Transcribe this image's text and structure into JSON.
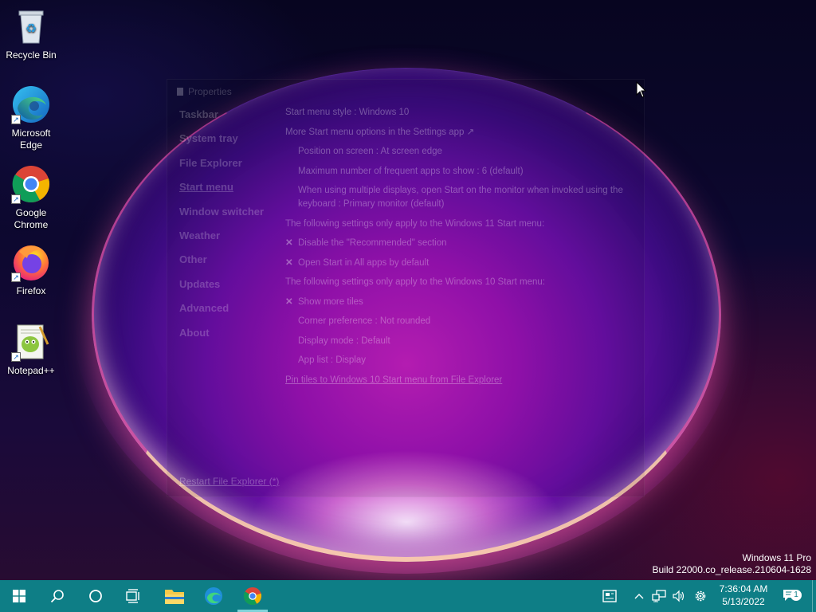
{
  "desktop": {
    "icons": [
      {
        "label": "Recycle Bin"
      },
      {
        "label": "Microsoft Edge"
      },
      {
        "label": "Google Chrome"
      },
      {
        "label": "Firefox"
      },
      {
        "label": "Notepad++"
      }
    ]
  },
  "properties": {
    "title": "Properties",
    "nav": [
      {
        "label": "Taskbar"
      },
      {
        "label": "System tray"
      },
      {
        "label": "File Explorer"
      },
      {
        "label": "Start menu"
      },
      {
        "label": "Window switcher"
      },
      {
        "label": "Weather"
      },
      {
        "label": "Other"
      },
      {
        "label": "Updates"
      },
      {
        "label": "Advanced"
      },
      {
        "label": "About"
      }
    ],
    "settings": {
      "start_menu_style": "Start menu style : Windows 10",
      "more_options": "More Start menu options in the Settings app ↗",
      "position": "Position on screen : At screen edge",
      "max_frequent": "Maximum number of frequent apps to show : 6 (default)",
      "multi_display": "When using multiple displays, open Start on the monitor when invoked using the keyboard : Primary monitor (default)",
      "win11_header": "The following settings only apply to the Windows 11 Start menu:",
      "disable_recommended": "Disable the \"Recommended\" section",
      "open_all_apps": "Open Start in All apps by default",
      "win10_header": "The following settings only apply to the Windows 10 Start menu:",
      "show_more_tiles": "Show more tiles",
      "corner_pref": "Corner preference : Not rounded",
      "display_mode": "Display mode : Default",
      "app_list": "App list : Display",
      "pin_tiles": "Pin tiles to Windows 10 Start menu from File Explorer"
    },
    "restart": "Restart File Explorer (*)"
  },
  "watermark": {
    "line1": "Windows 11 Pro",
    "line2": "Build 22000.co_release.210604-1628"
  },
  "taskbar": {
    "time": "7:36:04 AM",
    "date": "5/13/2022",
    "notification_count": "1"
  }
}
